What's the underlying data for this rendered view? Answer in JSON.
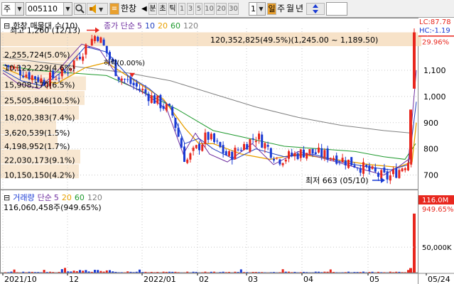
{
  "toolbar": {
    "market": "주",
    "code": "005110",
    "company": "한창",
    "period_buttons": [
      "분",
      "초",
      "틱",
      "1",
      "3",
      "5",
      "10",
      "20",
      "30"
    ],
    "period_value": "1",
    "day_label": "일",
    "week_label": "주",
    "month_label": "월",
    "year_label": "년"
  },
  "price_header": {
    "stock_name": "한창",
    "chart_kind": "매물대",
    "chart_kind_count": "수(10)",
    "ma_title": "종가 단순",
    "ma_periods": [
      "5",
      "10",
      "20",
      "60",
      "120"
    ],
    "lc_label": "LC:87.78",
    "hc_label": "HC:-1.19"
  },
  "annotations": {
    "high": "최고 1,260 (12/13)",
    "low": "최저 663 (05/10)",
    "max_volume_band": "120,352,825(49.5%)(1,245.00 ~ 1,189.50)",
    "band_labels": [
      "2,255,724(5.0%)",
      "10,122,229(4.6%)",
      "15,908,170(6.5%)",
      "25,505,846(10.5%)",
      "18,020,383(7.4%)",
      "3,620,539(1.5%)",
      "4,198,952(1.7%)",
      "22,030,173(9.1%)",
      "10,150,150(4.2%)"
    ],
    "drop_note": "하락(0.00%)"
  },
  "price_axis": {
    "ticks": [
      "1,100",
      "1,000",
      "900",
      "800",
      "700"
    ],
    "current_price": "1,245",
    "current_change": "29.96%"
  },
  "volume_header": {
    "title": "거래량",
    "ma_title": "단순",
    "ma_periods": [
      "5",
      "20",
      "60",
      "120"
    ],
    "total": "116,060,458주(949.65%)"
  },
  "volume_axis": {
    "ticks": [
      "50,000K"
    ],
    "current_volume": "116.0M",
    "current_pct": "949.65%"
  },
  "time_axis": [
    "2021/10",
    "12",
    "2022/01",
    "02",
    "03",
    "04",
    "05",
    "05/24"
  ],
  "colors": {
    "up": "#e8271e",
    "down": "#1a3bd4",
    "ma5": "#7030a0",
    "ma10": "#2040c0",
    "ma20": "#e8a000",
    "ma60": "#1f9a2e",
    "ma120": "#808080",
    "band": "#f6dfc2"
  },
  "chart_data": {
    "type": "candlestick",
    "period": "daily",
    "x": [
      "2021-10-04",
      "2021-11-01",
      "2021-12-01",
      "2021-12-13",
      "2022-01-03",
      "2022-02-03",
      "2022-03-02",
      "2022-04-01",
      "2022-05-02",
      "2022-05-10",
      "2022-05-24"
    ],
    "close": [
      1120,
      1060,
      1170,
      1220,
      1020,
      800,
      770,
      790,
      720,
      680,
      1245
    ],
    "high_point": {
      "label": "최고",
      "value": 1260,
      "date": "12/13"
    },
    "low_point": {
      "label": "최저",
      "value": 663,
      "date": "05/10"
    },
    "y_range": [
      650,
      1260
    ],
    "volume_last": 116060458
  }
}
